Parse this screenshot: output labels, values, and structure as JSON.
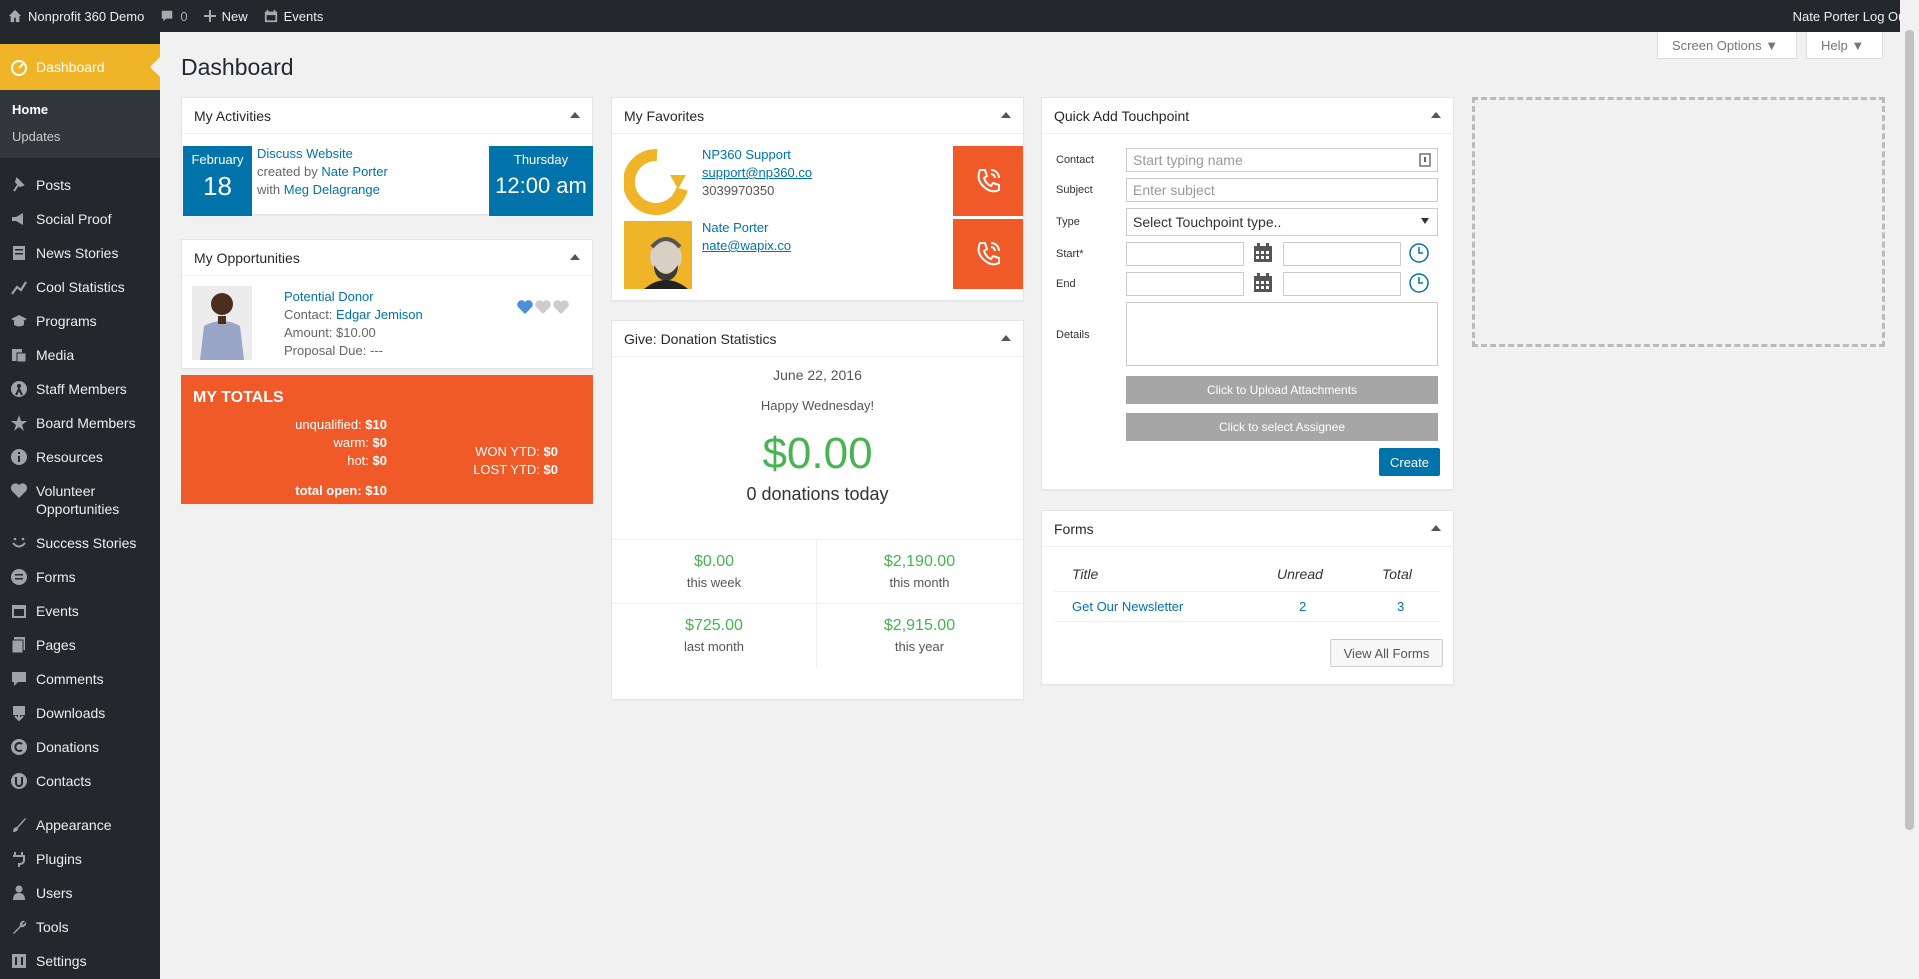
{
  "adminbar": {
    "site_name": "Nonprofit 360 Demo",
    "comments_count": "0",
    "new_label": "New",
    "events_label": "Events",
    "user_name": "Nate Porter",
    "logout": "Log Out"
  },
  "sidebar": {
    "dashboard": "Dashboard",
    "sub_home": "Home",
    "sub_updates": "Updates",
    "items": [
      {
        "label": "Posts",
        "icon": "pin-icon"
      },
      {
        "label": "Social Proof",
        "icon": "megaphone-icon"
      },
      {
        "label": "News Stories",
        "icon": "page-icon"
      },
      {
        "label": "Cool Statistics",
        "icon": "chart-icon"
      },
      {
        "label": "Programs",
        "icon": "graduation-icon"
      },
      {
        "label": "Media",
        "icon": "media-icon"
      },
      {
        "label": "Staff Members",
        "icon": "person-icon"
      },
      {
        "label": "Board Members",
        "icon": "star-icon"
      },
      {
        "label": "Resources",
        "icon": "info-icon"
      },
      {
        "label": "Volunteer Opportunities",
        "icon": "heart-icon"
      },
      {
        "label": "Success Stories",
        "icon": "smile-icon"
      },
      {
        "label": "Forms",
        "icon": "forms-icon"
      },
      {
        "label": "Events",
        "icon": "calendar-icon"
      },
      {
        "label": "Pages",
        "icon": "pages-icon"
      },
      {
        "label": "Comments",
        "icon": "comment-icon"
      },
      {
        "label": "Downloads",
        "icon": "download-icon"
      },
      {
        "label": "Donations",
        "icon": "donation-icon"
      },
      {
        "label": "Contacts",
        "icon": "contacts-icon"
      }
    ],
    "items2": [
      {
        "label": "Appearance",
        "icon": "brush-icon"
      },
      {
        "label": "Plugins",
        "icon": "plugin-icon"
      },
      {
        "label": "Users",
        "icon": "users-icon"
      },
      {
        "label": "Tools",
        "icon": "wrench-icon"
      },
      {
        "label": "Settings",
        "icon": "settings-icon"
      }
    ]
  },
  "header": {
    "title": "Dashboard",
    "screen_options": "Screen Options ▼",
    "help": "Help ▼"
  },
  "activities": {
    "title": "My Activities",
    "month": "February",
    "day": "18",
    "activity": "Discuss Website",
    "created_by_prefix": "created by",
    "created_by": "Nate Porter",
    "with_prefix": "with",
    "with": "Meg Delagrange",
    "weekday": "Thursday",
    "time": "12:00 am"
  },
  "opportunities": {
    "title": "My Opportunities",
    "name": "Potential Donor",
    "contact_prefix": "Contact:",
    "contact": "Edgar Jemison",
    "amount": "Amount: $10.00",
    "due": "Proposal Due: ---",
    "hearts_filled": 1,
    "hearts_total": 3
  },
  "totals": {
    "title": "MY TOTALS",
    "unqualified_label": "unqualified:",
    "unqualified": "$10",
    "warm_label": "warm:",
    "warm": "$0",
    "hot_label": "hot:",
    "hot": "$0",
    "won_label": "WON YTD:",
    "won": "$0",
    "lost_label": "LOST YTD:",
    "lost": "$0",
    "total_label": "total open:",
    "total": "$10"
  },
  "favorites": {
    "title": "My Favorites",
    "items": [
      {
        "name": "NP360 Support",
        "email": "support@np360.co",
        "phone": "3039970350"
      },
      {
        "name": "Nate Porter",
        "email": "nate@wapix.co",
        "phone": ""
      }
    ]
  },
  "donations": {
    "title": "Give: Donation Statistics",
    "date": "June 22, 2016",
    "greeting": "Happy Wednesday!",
    "today_amount": "$0.00",
    "today_label": "0 donations today",
    "stats": [
      {
        "value": "$0.00",
        "label": "this week"
      },
      {
        "value": "$2,190.00",
        "label": "this month"
      },
      {
        "value": "$725.00",
        "label": "last month"
      },
      {
        "value": "$2,915.00",
        "label": "this year"
      }
    ]
  },
  "touchpoint": {
    "title": "Quick Add Touchpoint",
    "contact_label": "Contact",
    "contact_placeholder": "Start typing name",
    "subject_label": "Subject",
    "subject_placeholder": "Enter subject",
    "type_label": "Type",
    "type_value": "Select Touchpoint type..",
    "start_label": "Start*",
    "end_label": "End",
    "details_label": "Details",
    "upload_btn": "Click to Upload Attachments",
    "assignee_btn": "Click to select Assignee",
    "create_btn": "Create"
  },
  "forms": {
    "title": "Forms",
    "col_title": "Title",
    "col_unread": "Unread",
    "col_total": "Total",
    "rows": [
      {
        "title": "Get Our Newsletter",
        "unread": "2",
        "total": "3"
      }
    ],
    "view_all": "View All Forms"
  },
  "colors": {
    "accent": "#f0b429",
    "brand_blue": "#0073aa",
    "orange": "#f05a28",
    "green": "#46b450",
    "sidebar": "#23282d"
  }
}
